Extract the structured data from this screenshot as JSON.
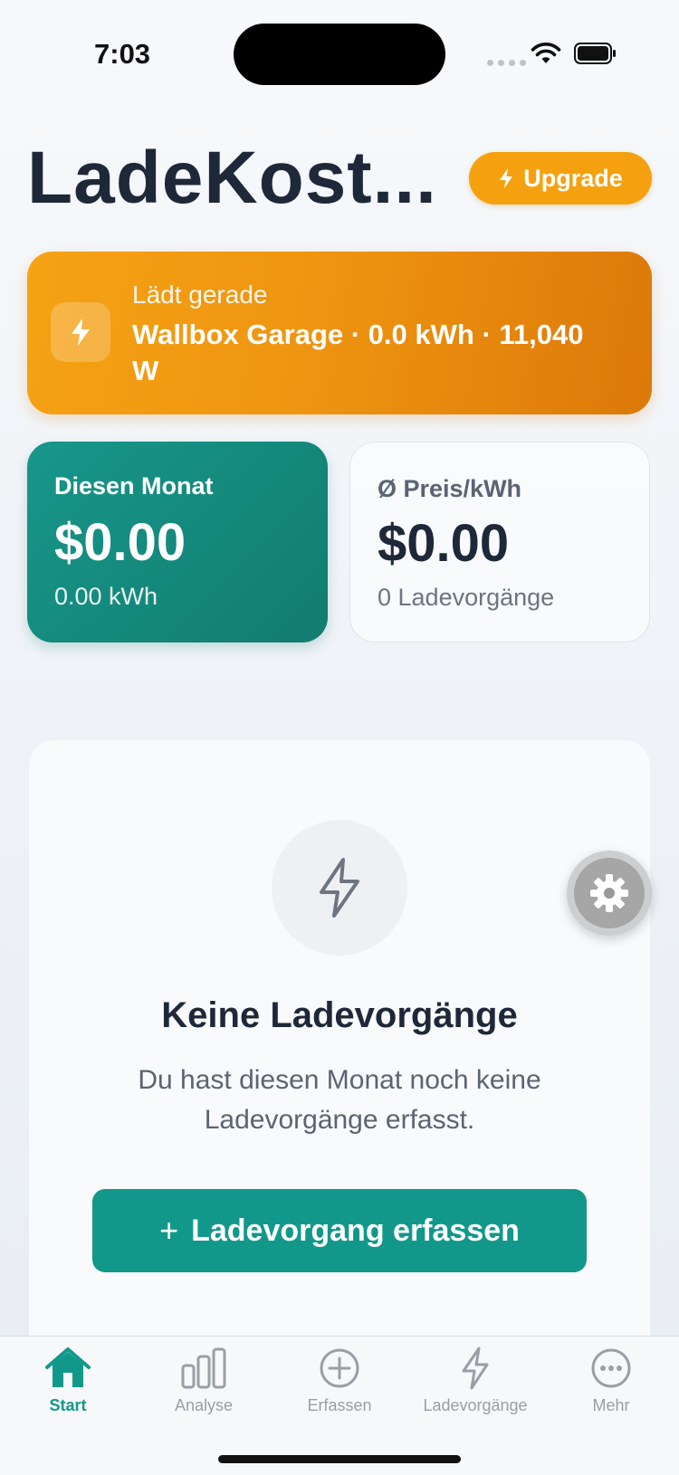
{
  "status_bar": {
    "time": "7:03"
  },
  "header": {
    "title": "LadeKost...",
    "upgrade_label": "Upgrade"
  },
  "charging": {
    "label": "Lädt gerade",
    "detail": "Wallbox Garage · 0.0 kWh · 11,040 W"
  },
  "stats": {
    "month": {
      "title": "Diesen Monat",
      "value": "$0.00",
      "sub": "0.00 kWh"
    },
    "price": {
      "title": "Ø Preis/kWh",
      "value": "$0.00",
      "sub": "0 Ladevorgänge"
    }
  },
  "empty_state": {
    "title": "Keine Ladevorgänge",
    "description": "Du hast diesen Monat noch keine Ladevorgänge erfasst.",
    "button_label": "Ladevorgang erfassen",
    "button_plus": "+"
  },
  "tab_bar": {
    "active": "Start",
    "tabs": [
      {
        "label": "Start",
        "icon": "house-icon"
      },
      {
        "label": "Analyse",
        "icon": "bar-chart-icon"
      },
      {
        "label": "Erfassen",
        "icon": "plus-circle-icon"
      },
      {
        "label": "Ladevorgänge",
        "icon": "bolt-icon"
      },
      {
        "label": "Mehr",
        "icon": "more-circle-icon"
      }
    ]
  },
  "colors": {
    "accent_teal": "#12988a",
    "accent_orange": "#f5a10f",
    "text_dark": "#1e2838"
  }
}
